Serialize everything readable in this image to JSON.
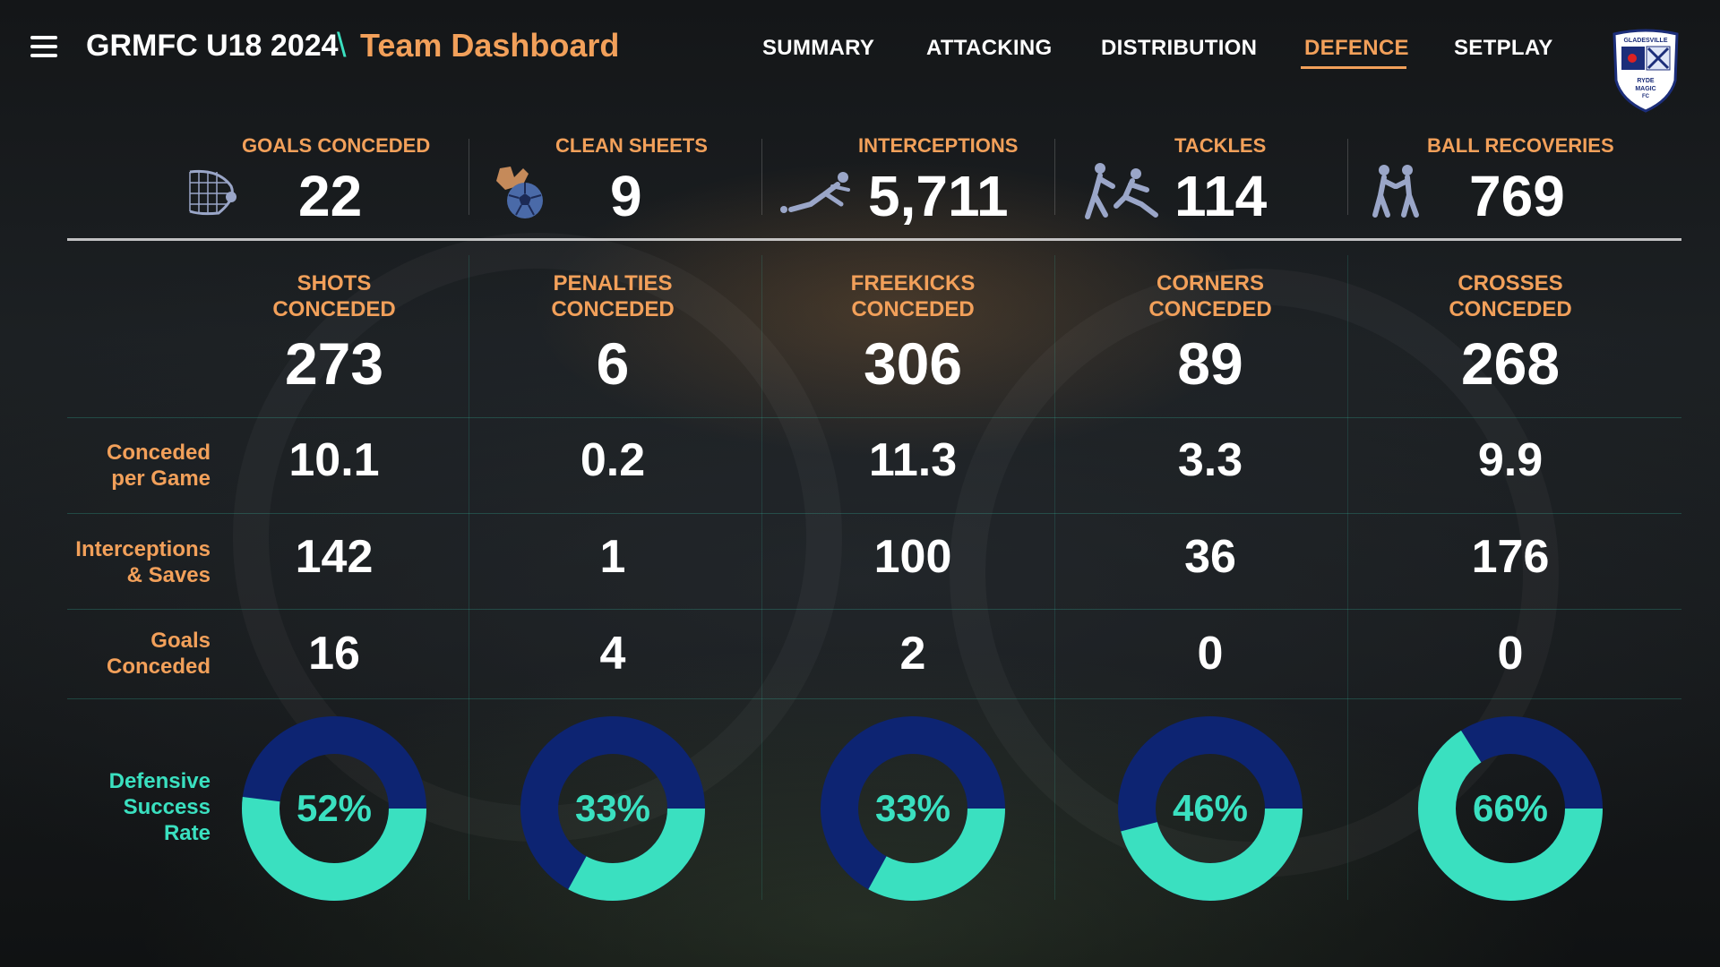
{
  "header": {
    "title": "GRMFC U18 2024",
    "separator": "\\",
    "subtitle": "Team Dashboard",
    "nav": [
      {
        "label": "SUMMARY",
        "active": false
      },
      {
        "label": "ATTACKING",
        "active": false
      },
      {
        "label": "DISTRIBUTION",
        "active": false
      },
      {
        "label": "DEFENCE",
        "active": true
      },
      {
        "label": "SETPLAY",
        "active": false
      }
    ],
    "logo_text": "GLADESVILLE RYDE MAGIC FC"
  },
  "kpis": [
    {
      "label": "GOALS CONCEDED",
      "value": "22",
      "icon": "goal-net-icon"
    },
    {
      "label": "CLEAN SHEETS",
      "value": "9",
      "icon": "gloves-ball-icon"
    },
    {
      "label": "INTERCEPTIONS",
      "value": "5,711",
      "icon": "slide-tackle-icon"
    },
    {
      "label": "TACKLES",
      "value": "114",
      "icon": "tackle-players-icon"
    },
    {
      "label": "BALL RECOVERIES",
      "value": "769",
      "icon": "players-group-icon"
    }
  ],
  "columns": [
    {
      "head1": "SHOTS",
      "head2": "CONCEDED",
      "total": "273",
      "per_game": "10.1",
      "interceptions_saves": "142",
      "goals_conceded": "16",
      "success_rate": 52,
      "success_label": "52%"
    },
    {
      "head1": "PENALTIES",
      "head2": "CONCEDED",
      "total": "6",
      "per_game": "0.2",
      "interceptions_saves": "1",
      "goals_conceded": "4",
      "success_rate": 33,
      "success_label": "33%"
    },
    {
      "head1": "FREEKICKS",
      "head2": "CONCEDED",
      "total": "306",
      "per_game": "11.3",
      "interceptions_saves": "100",
      "goals_conceded": "2",
      "success_rate": 33,
      "success_label": "33%"
    },
    {
      "head1": "CORNERS",
      "head2": "CONCEDED",
      "total": "89",
      "per_game": "3.3",
      "interceptions_saves": "36",
      "goals_conceded": "0",
      "success_rate": 46,
      "success_label": "46%"
    },
    {
      "head1": "CROSSES",
      "head2": "CONCEDED",
      "total": "268",
      "per_game": "9.9",
      "interceptions_saves": "176",
      "goals_conceded": "0",
      "success_rate": 66,
      "success_label": "66%"
    }
  ],
  "row_labels": {
    "per_game_1": "Conceded",
    "per_game_2": "per Game",
    "saves_1": "Interceptions",
    "saves_2": "& Saves",
    "goals_1": "Goals",
    "goals_2": "Conceded",
    "rate_1": "Defensive",
    "rate_2": "Success",
    "rate_3": "Rate"
  },
  "colors": {
    "accent_orange": "#f2a05a",
    "accent_teal": "#3ae0c0",
    "donut_track": "#0d2472",
    "text_white": "#ffffff"
  }
}
